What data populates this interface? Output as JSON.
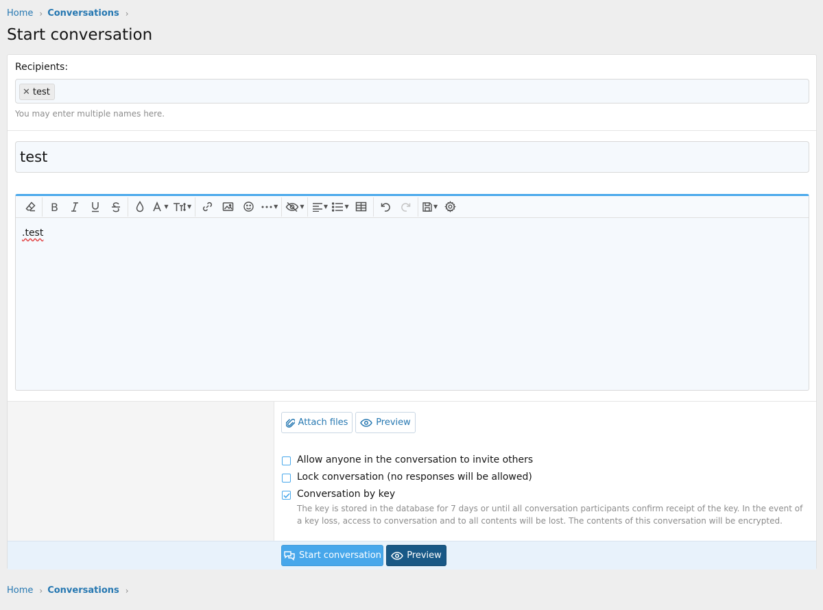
{
  "breadcrumb": {
    "home": "Home",
    "conversations": "Conversations"
  },
  "page": {
    "title": "Start conversation"
  },
  "recipients": {
    "label": "Recipients:",
    "tokens": [
      "test"
    ],
    "hint": "You may enter multiple names here."
  },
  "title_input": {
    "value": "test"
  },
  "editor": {
    "content": ".test",
    "toolbar": [
      "eraser-icon",
      "bold-icon",
      "italic-icon",
      "underline-icon",
      "strikethrough-icon",
      "color-drop-icon",
      "font-family-icon",
      "font-size-icon",
      "link-icon",
      "image-icon",
      "smiley-icon",
      "more-icon",
      "spoiler-icon",
      "align-icon",
      "list-icon",
      "table-icon",
      "undo-icon",
      "redo-icon",
      "drafts-icon",
      "settings-icon"
    ]
  },
  "actions": {
    "attach_label": "Attach files",
    "preview_label": "Preview"
  },
  "options": [
    {
      "label": "Allow anyone in the conversation to invite others",
      "checked": false
    },
    {
      "label": "Lock conversation (no responses will be allowed)",
      "checked": false
    },
    {
      "label": "Conversation by key",
      "checked": true,
      "description": "The key is stored in the database for 7 days or until all conversation participants confirm receipt of the key. In the event of a key loss, access to conversation and to all contents will be lost. The contents of this conversation will be encrypted."
    }
  ],
  "footer": {
    "submit_label": "Start conversation",
    "preview_label": "Preview"
  },
  "colors": {
    "accent": "#47a7eb",
    "link": "#2577b1",
    "dark_button": "#185886"
  }
}
